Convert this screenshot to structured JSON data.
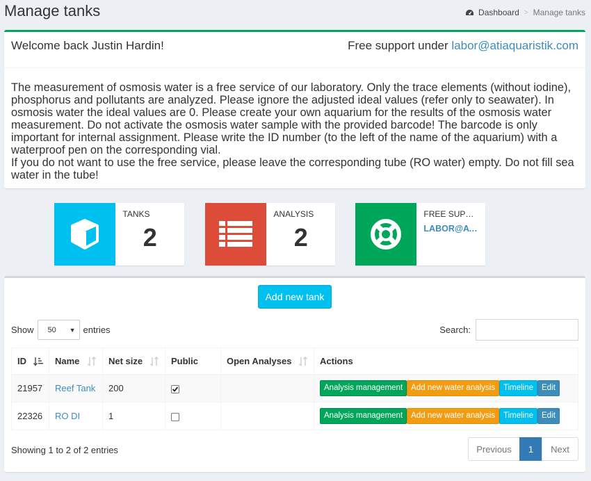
{
  "header": {
    "title": "Manage tanks",
    "breadcrumb": {
      "home": "Dashboard",
      "current": "Manage tanks"
    }
  },
  "welcome": {
    "greeting": "Welcome back Justin Hardin!",
    "support_prefix": "Free support under",
    "support_email": "labor@atiaquaristik.com",
    "paragraph1": "The measurement of osmosis water is a free service of our laboratory. Only the trace elements (without iodine), phosphorus and pollutants are analyzed. Please ignore the adjusted ideal values (refer only to seawater). In osmosis water the ideal values are 0. Please create your own aquarium for the results of the osmosis water measurement. Do not activate the osmosis water sample with the provided barcode! The barcode is only important for internal assignment. Please write the ID number (to the left of the name of the aquarium) with a waterproof pen on the corresponding vial.",
    "paragraph2": "If you do not want to use the free service, please leave the corresponding tube (RO water) empty. Do not fill sea water in the tube!"
  },
  "info_boxes": [
    {
      "label": "TANKS",
      "value": "2",
      "color": "#00c0ef",
      "icon": "cube-icon"
    },
    {
      "label": "ANALYSIS",
      "value": "2",
      "color": "#dd4b39",
      "icon": "list-icon"
    },
    {
      "label": "FREE SUPPORT",
      "value": "LABOR@ATIAQUARISTIK.COM",
      "color": "#00a65a",
      "icon": "life-ring-icon"
    }
  ],
  "tanks": {
    "add_button": "Add new tank",
    "length": {
      "show": "Show",
      "value": "50",
      "entries": "entries"
    },
    "search_label": "Search:",
    "search_value": "",
    "columns": [
      "ID",
      "Name",
      "Net size",
      "Public",
      "Open Analyses",
      "Actions"
    ],
    "rows": [
      {
        "id": "21957",
        "name": "Reef Tank",
        "net_size": "200",
        "public": true,
        "open_analyses": ""
      },
      {
        "id": "22326",
        "name": "RO DI",
        "net_size": "1",
        "public": false,
        "open_analyses": ""
      }
    ],
    "actions": {
      "analysis_management": "Analysis management",
      "add_water_analysis": "Add new water analysis",
      "timeline": "Timeline",
      "edit": "Edit"
    },
    "info": "Showing 1 to 2 of 2 entries",
    "pagination": {
      "previous": "Previous",
      "page": "1",
      "next": "Next"
    }
  }
}
